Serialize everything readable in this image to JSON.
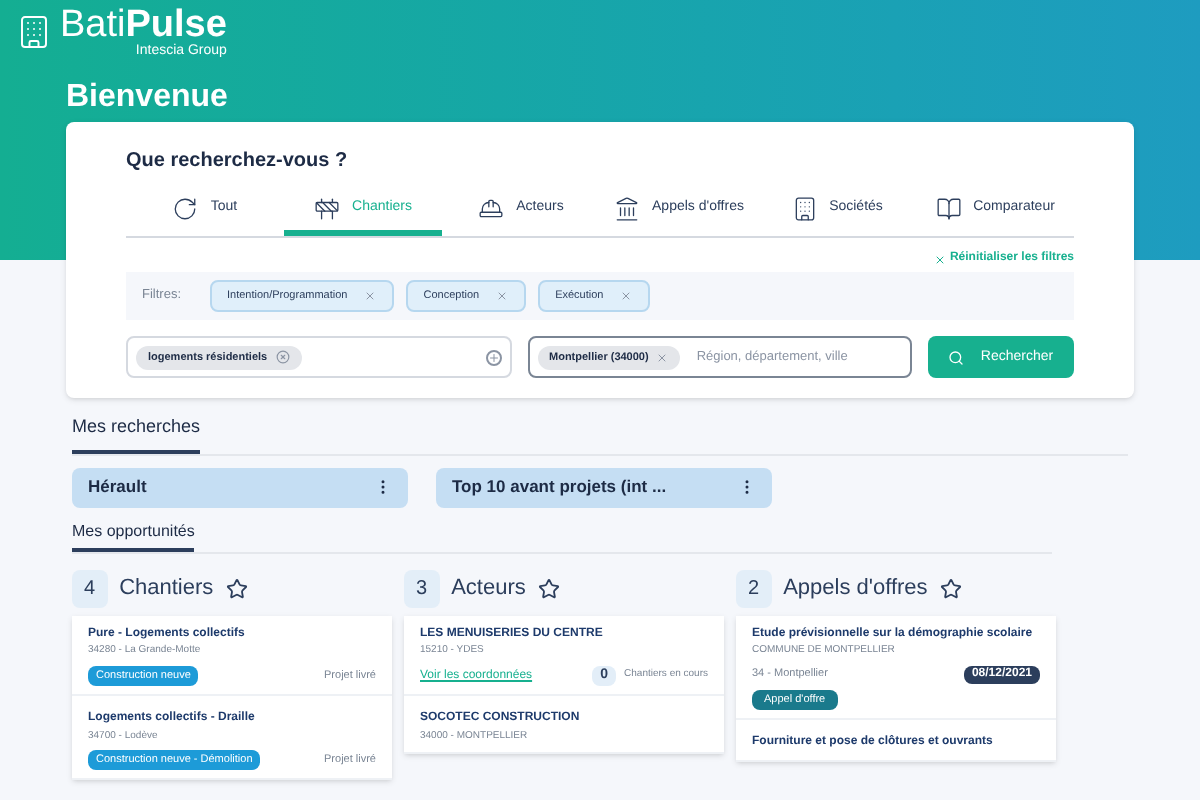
{
  "brand": {
    "name_light": "Bati",
    "name_bold": "Pulse",
    "subtitle": "Intescia Group"
  },
  "page_title": "Bienvenue",
  "search": {
    "title": "Que recherchez-vous ?",
    "tabs": [
      {
        "label": "Tout",
        "selected": false
      },
      {
        "label": "Chantiers",
        "selected": true
      },
      {
        "label": "Acteurs",
        "selected": false
      },
      {
        "label": "Appels d'offres",
        "selected": false
      },
      {
        "label": "Sociétés",
        "selected": false
      },
      {
        "label": "Comparateur",
        "selected": false
      }
    ],
    "reset_filters": "Réinitialiser les filtres",
    "filters_label": "Filtres:",
    "filters": [
      "Intention/Programmation",
      "Conception",
      "Exécution"
    ],
    "keyword_chips": [
      "logements résidentiels"
    ],
    "location_chips": [
      "Montpellier (34000)"
    ],
    "location_placeholder": "Région, département, ville",
    "button": "Rechercher"
  },
  "my_searches": {
    "title": "Mes recherches",
    "items": [
      "Hérault",
      "Top 10 avant projets (int ..."
    ]
  },
  "opportunities": {
    "title": "Mes opportunités",
    "columns": [
      {
        "count": "4",
        "title": "Chantiers",
        "kind": "project",
        "items": [
          {
            "title": "Pure - Logements collectifs",
            "subtitle": "34280 - La Grande-Motte",
            "tag": "Construction neuve",
            "status": "Projet livré"
          },
          {
            "title": "Logements collectifs - Draille",
            "subtitle": "34700 - Lodève",
            "tag": "Construction neuve - Démolition",
            "status": "Projet livré"
          }
        ]
      },
      {
        "count": "3",
        "title": "Acteurs",
        "kind": "actor",
        "items": [
          {
            "title": "LES MENUISERIES DU CENTRE",
            "subtitle": "15210 - YDES",
            "link": "Voir les coordonnées",
            "number": "0",
            "number_label": "Chantiers en cours"
          },
          {
            "title": "SOCOTEC CONSTRUCTION",
            "subtitle": "34000 - MONTPELLIER"
          }
        ]
      },
      {
        "count": "2",
        "title": "Appels d'offres",
        "kind": "tender",
        "items": [
          {
            "title": "Etude prévisionnelle sur la démographie scolaire",
            "subtitle": "COMMUNE DE MONTPELLIER",
            "location": "34 - Montpellier",
            "date": "08/12/2021",
            "tag": "Appel d'offre"
          },
          {
            "title": "Fourniture et pose de clôtures et ouvrants"
          }
        ]
      }
    ]
  }
}
